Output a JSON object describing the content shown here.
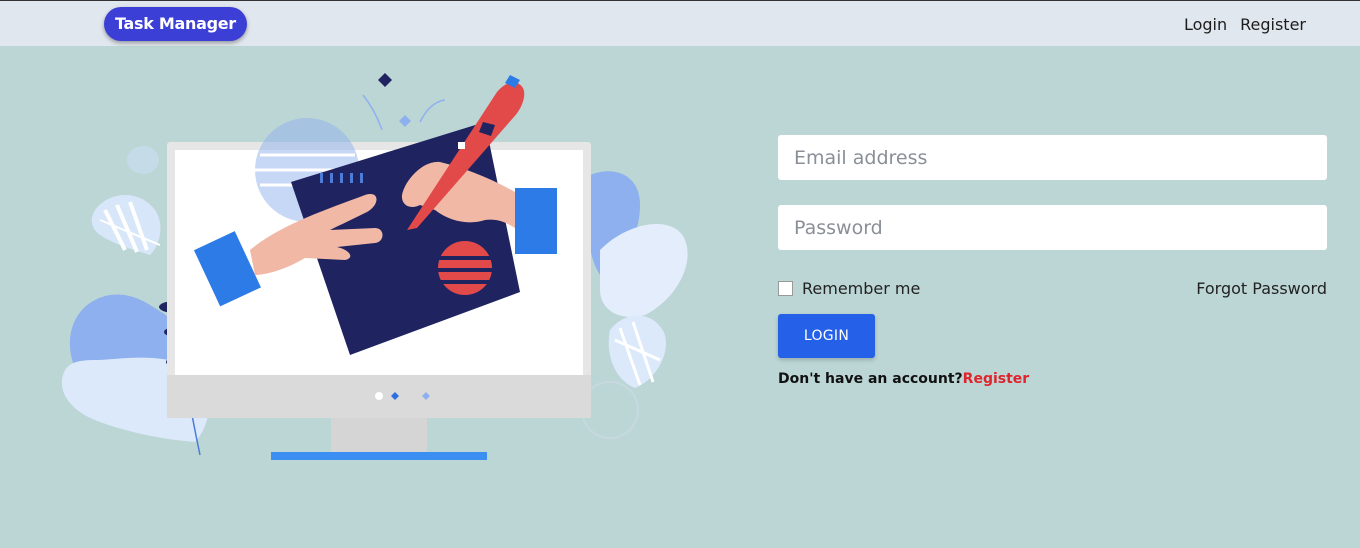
{
  "header": {
    "brand": "Task Manager",
    "nav": {
      "login": "Login",
      "register": "Register"
    }
  },
  "form": {
    "email_placeholder": "Email address",
    "password_placeholder": "Password",
    "remember_label": "Remember me",
    "forgot_label": "Forgot Password",
    "login_button": "LOGIN",
    "signup_prompt": "Don't have an account?",
    "signup_link": "Register"
  },
  "colors": {
    "background": "#bcd6d6",
    "header": "#e1e7ee",
    "brand": "#3c3fd6",
    "primary": "#2460e8",
    "link_accent": "#e0242c"
  },
  "illustration": {
    "description_icon": "monitor-drawing-illustration"
  }
}
